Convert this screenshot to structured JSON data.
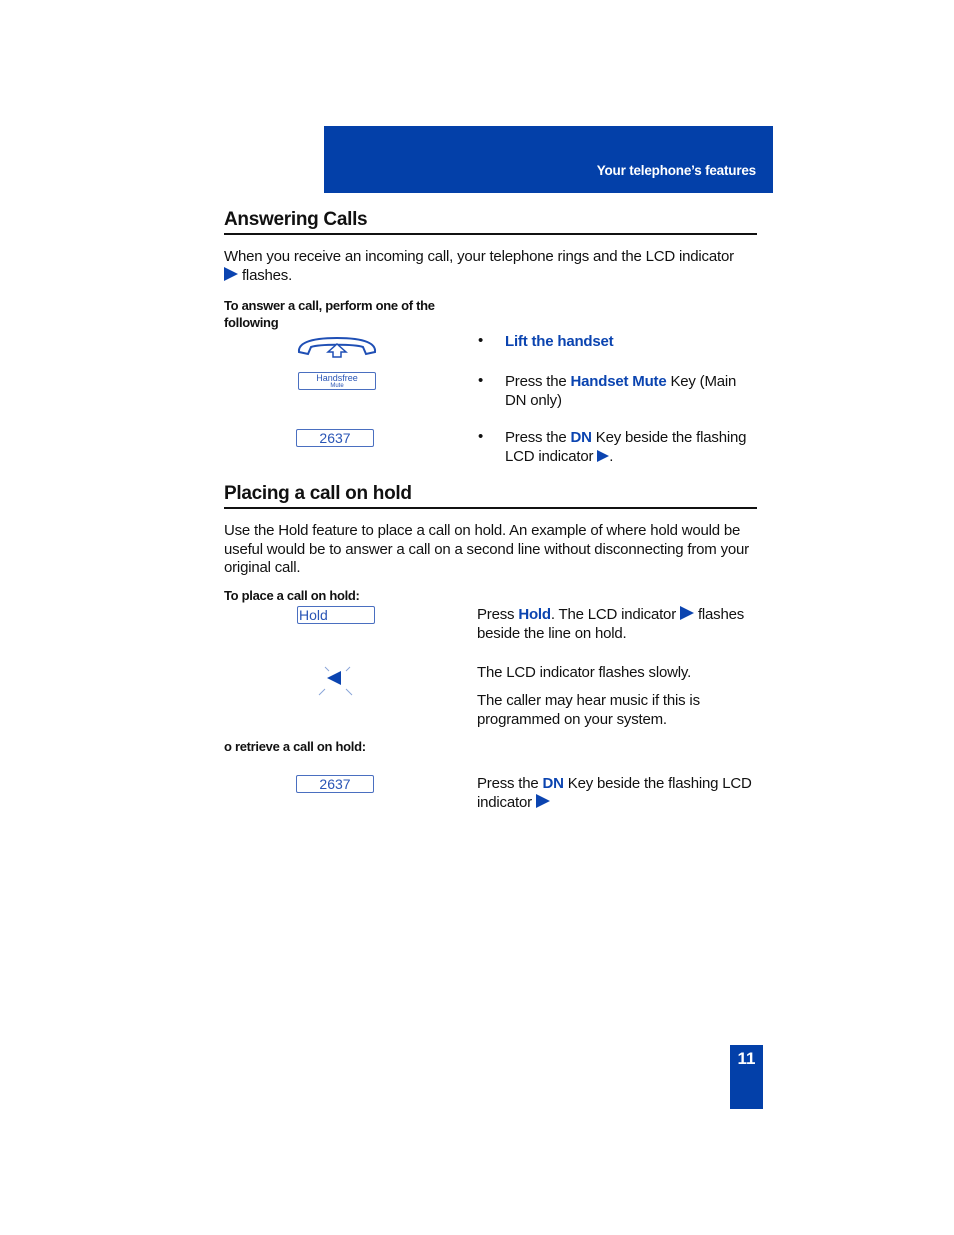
{
  "header": {
    "title": "Your telephone’s features"
  },
  "colors": {
    "brand_blue": "#0340a9",
    "highlight_blue": "#0b44b0",
    "key_border": "#4a6fc0"
  },
  "answering": {
    "title": "Answering Calls",
    "intro_line1": "When you receive an incoming call, your telephone rings and the LCD indicator",
    "intro_line2": "flashes.",
    "sublabel": "To answer a call, perform one of the following",
    "steps": [
      {
        "icon": "handset-lift-icon",
        "highlight": "Lift the handset"
      },
      {
        "key_label_1": "Handsfree",
        "key_label_2": "Mute",
        "pre": "Press the ",
        "highlight": "Handset Mute",
        "post": " Key (Main DN only)"
      },
      {
        "key_label": "2637",
        "pre": "Press the ",
        "highlight": "DN",
        "post": " Key beside the flashing LCD indicator",
        "end": "."
      }
    ]
  },
  "hold": {
    "title": "Placing a call on hold",
    "intro": "Use the Hold feature to place a call on hold.  An example of  where hold would be useful would be to answer a call on a second line without disconnecting from your original call.",
    "place_label": "To place a call on hold:",
    "hold_key_label": "Hold",
    "step1_pre": "Press ",
    "step1_highlight": "Hold",
    "step1_mid": ". The LCD indicator",
    "step1_post": "flashes beside the line on hold.",
    "step2": "The LCD indicator flashes slowly.",
    "step3": "The caller may hear music if this is programmed on your system.",
    "retrieve_label": "o retrieve a call on hold:",
    "retrieve_key_label": "2637",
    "retrieve_pre": "Press the ",
    "retrieve_highlight": "DN",
    "retrieve_post": " Key beside the flashing LCD indicator"
  },
  "footer": {
    "page_number": "11"
  }
}
